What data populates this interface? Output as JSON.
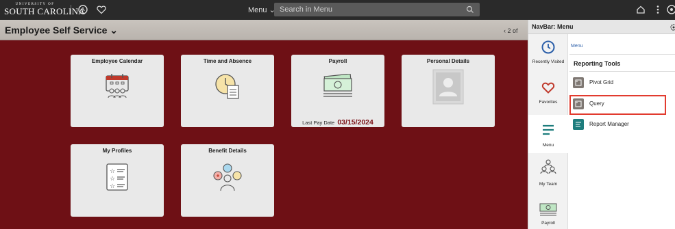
{
  "header": {
    "logo_top": "UNIVERSITY OF",
    "logo_main": "SOUTH CAROLINA",
    "menu_label": "Menu ⌄",
    "search_placeholder": "Search in Menu"
  },
  "page": {
    "title": "Employee Self Service ⌄",
    "pager": "‹  2 of"
  },
  "tiles": [
    {
      "title": "Employee Calendar"
    },
    {
      "title": "Time and Absence"
    },
    {
      "title": "Payroll",
      "last_pay_label": "Last Pay Date",
      "last_pay_value": "03/15/2024"
    },
    {
      "title": "Personal Details"
    },
    {
      "title": "My Profiles"
    },
    {
      "title": "Benefit Details"
    }
  ],
  "navbar": {
    "title": "NavBar: Menu",
    "breadcrumb": "Menu",
    "section_title": "Reporting Tools",
    "left_items": [
      {
        "label": "Recently Visited",
        "icon": "clock-icon"
      },
      {
        "label": "Favorites",
        "icon": "heart-icon"
      },
      {
        "label": "Menu",
        "icon": "hamburger-icon"
      },
      {
        "label": "My Team",
        "icon": "team-icon"
      },
      {
        "label": "Payroll",
        "icon": "cash-icon"
      }
    ],
    "menu_items": [
      {
        "label": "Pivot Grid",
        "icon": "folder-icon"
      },
      {
        "label": "Query",
        "icon": "folder-icon"
      },
      {
        "label": "Report Manager",
        "icon": "report-icon"
      }
    ]
  },
  "colors": {
    "maroon": "#6e1015",
    "accent_teal": "#1e7d7d",
    "highlight_red": "#e23b2f"
  }
}
